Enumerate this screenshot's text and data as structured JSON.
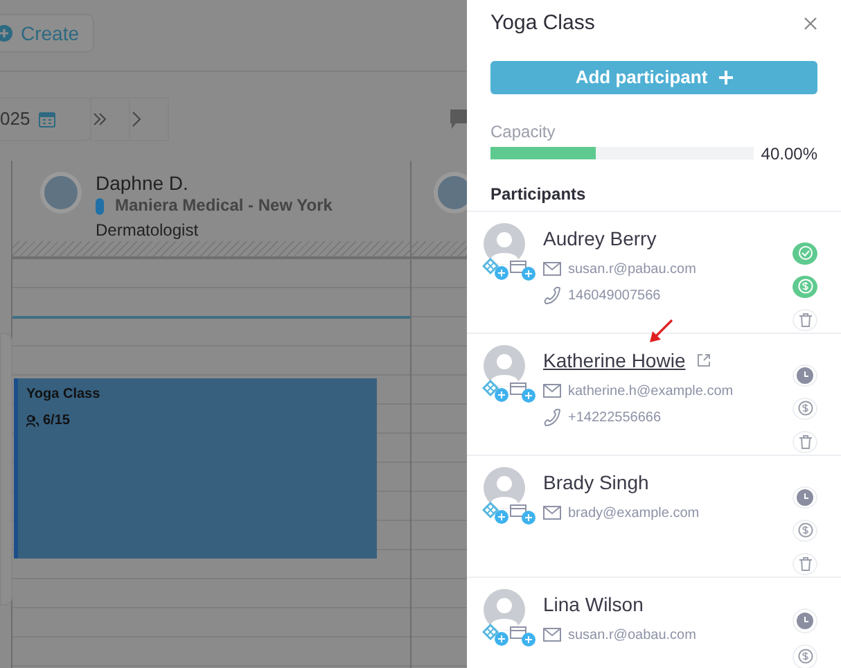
{
  "calendar": {
    "create_button": "Create",
    "date_text": "025",
    "resource": {
      "name": "Daphne D.",
      "location": "Maniera Medical - New York",
      "role": "Dermatologist"
    },
    "event": {
      "title": "Yoga Class",
      "count": "6/15"
    }
  },
  "panel": {
    "title": "Yoga Class",
    "add_button": "Add participant",
    "capacity": {
      "label": "Capacity",
      "level": 0.4,
      "reading": "40.00%"
    },
    "participants_heading": "Participants",
    "participants": [
      {
        "name": "Audrey Berry",
        "email": "susan.r@pabau.com",
        "phone": "146049007566",
        "checked_in": true,
        "paid": true,
        "hovered": false
      },
      {
        "name": "Katherine Howie",
        "email": "katherine.h@example.com",
        "phone": "+14222556666",
        "checked_in": false,
        "paid": false,
        "hovered": true
      },
      {
        "name": "Brady Singh",
        "email": "brady@example.com",
        "checked_in": false,
        "paid": false,
        "hovered": false
      },
      {
        "name": "Lina Wilson",
        "email": "susan.r@oabau.com",
        "checked_in": false,
        "paid": false,
        "hovered": false
      }
    ]
  }
}
